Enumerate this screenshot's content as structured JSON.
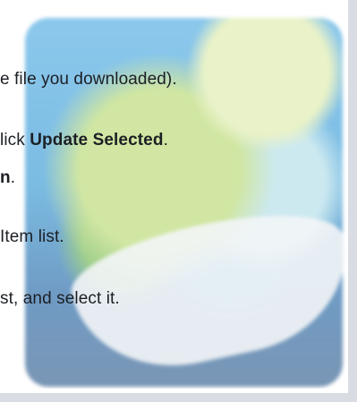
{
  "instructions": {
    "line1": "e file you downloaded).",
    "line2_prefix": "lick ",
    "line2_bold": "Update Selected",
    "line2_suffix": ".",
    "line3_bold": "n",
    "line3_suffix": ".",
    "line4": " Item list.",
    "line5": "st, and select it."
  },
  "colors": {
    "text": "#1c1f24",
    "border": "#d9dde3"
  }
}
